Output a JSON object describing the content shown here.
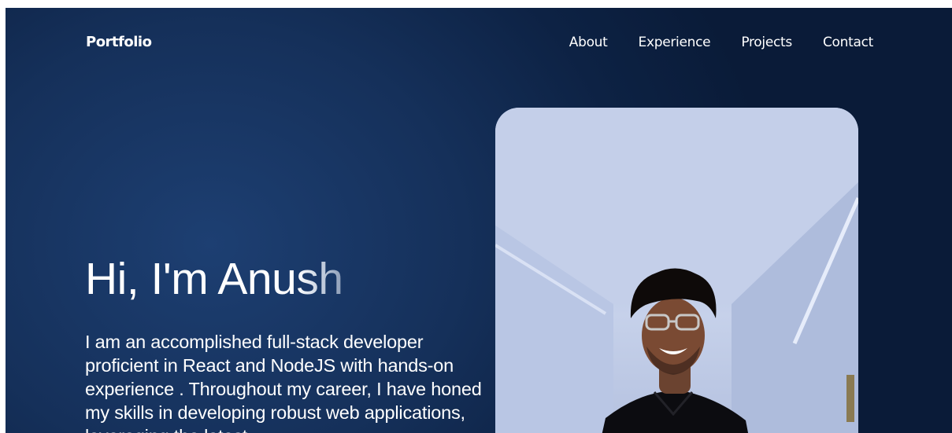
{
  "navbar": {
    "logo": "Portfolio",
    "links": [
      {
        "label": "About"
      },
      {
        "label": "Experience"
      },
      {
        "label": "Projects"
      },
      {
        "label": "Contact"
      }
    ]
  },
  "hero": {
    "title_main": "Hi, I'm Anu",
    "title_fade": "sh",
    "description": "I am an accomplished full-stack developer proficient in React and NodeJS with hands-on experience . Throughout my career, I have honed my skills in developing robust web applications, leveraging the latest"
  },
  "colors": {
    "background": "#15305a",
    "text": "#ffffff",
    "photo_wall": "#b6c4e3"
  }
}
